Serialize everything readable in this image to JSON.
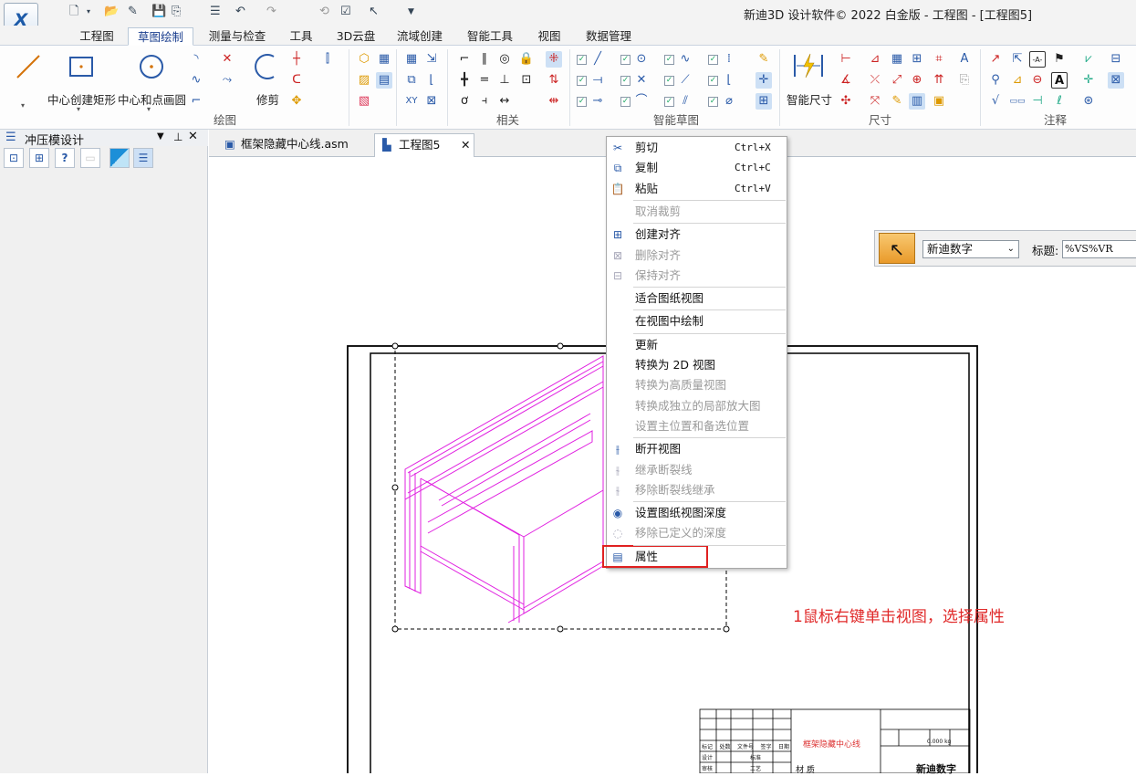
{
  "window": {
    "title": "新迪3D 设计软件© 2022 白金版 - 工程图 - [工程图5]"
  },
  "ribbon_tabs": [
    "工程图",
    "草图绘制",
    "测量与检查",
    "工具",
    "3D云盘",
    "流域创建",
    "智能工具",
    "视图",
    "数据管理"
  ],
  "ribbon": {
    "draw_big": [
      "中心创建矩形",
      "中心和点画圆"
    ],
    "trim_label": "修剪",
    "smart_dim_label": "智能尺寸",
    "group_labels": {
      "draw": "绘图",
      "relate": "相关",
      "smart_sketch": "智能草图",
      "dimension": "尺寸",
      "annotate": "注释"
    }
  },
  "left_panel": {
    "title": "冲压模设计"
  },
  "doc_tabs": [
    {
      "label": "框架隐藏中心线.asm",
      "active": false
    },
    {
      "label": "工程图5",
      "active": true,
      "close": "✕"
    }
  ],
  "context_menu": [
    {
      "type": "item",
      "label": "剪切",
      "shortcut": "Ctrl+X",
      "icon": "scissors-icon",
      "enabled": true
    },
    {
      "type": "item",
      "label": "复制",
      "shortcut": "Ctrl+C",
      "icon": "copy-icon",
      "enabled": true
    },
    {
      "type": "item",
      "label": "粘贴",
      "shortcut": "Ctrl+V",
      "icon": "paste-icon",
      "enabled": true
    },
    {
      "type": "sep"
    },
    {
      "type": "item",
      "label": "取消裁剪",
      "enabled": false
    },
    {
      "type": "sep"
    },
    {
      "type": "item",
      "label": "创建对齐",
      "icon": "align-create-icon",
      "enabled": true
    },
    {
      "type": "item",
      "label": "删除对齐",
      "icon": "align-delete-icon",
      "enabled": false
    },
    {
      "type": "item",
      "label": "保持对齐",
      "icon": "align-keep-icon",
      "enabled": false
    },
    {
      "type": "sep"
    },
    {
      "type": "item",
      "label": "适合图纸视图",
      "enabled": true
    },
    {
      "type": "sep"
    },
    {
      "type": "item",
      "label": "在视图中绘制",
      "enabled": true
    },
    {
      "type": "sep"
    },
    {
      "type": "item",
      "label": "更新",
      "enabled": true
    },
    {
      "type": "item",
      "label": "转换为 2D 视图",
      "enabled": true
    },
    {
      "type": "item",
      "label": "转换为高质量视图",
      "enabled": false
    },
    {
      "type": "item",
      "label": "转换成独立的局部放大图",
      "enabled": false
    },
    {
      "type": "item",
      "label": "设置主位置和备选位置",
      "enabled": false
    },
    {
      "type": "sep"
    },
    {
      "type": "item",
      "label": "断开视图",
      "icon": "break-view-icon",
      "enabled": true
    },
    {
      "type": "item",
      "label": "继承断裂线",
      "icon": "inherit-break-icon",
      "enabled": false
    },
    {
      "type": "item",
      "label": "移除断裂线继承",
      "icon": "remove-break-icon",
      "enabled": false
    },
    {
      "type": "sep"
    },
    {
      "type": "item",
      "label": "设置图纸视图深度",
      "icon": "depth-icon",
      "enabled": true
    },
    {
      "type": "item",
      "label": "移除已定义的深度",
      "icon": "remove-depth-icon",
      "enabled": false
    },
    {
      "type": "sep"
    },
    {
      "type": "item",
      "label": "属性",
      "icon": "properties-icon",
      "enabled": true,
      "highlighted": true
    }
  ],
  "float_toolbar": {
    "font_select": "新迪数字",
    "title_label": "标题:",
    "title_value": "%VS%VR"
  },
  "annotation": "1鼠标右键单击视图，选择属性",
  "title_block": {
    "drawing_name": "框架隐藏中心线",
    "row_labels": [
      "标记",
      "处数",
      "文件号",
      "签字",
      "日期"
    ],
    "row_labels2": [
      "设计",
      "标准",
      "审核",
      "工艺"
    ],
    "material": "材 质",
    "mass": "0.000 kg",
    "company": "新迪数字"
  },
  "colors": {
    "accent": "#1a3e8e",
    "annotation": "#e02828",
    "model": "#e020e0",
    "highlight": "#e02020"
  }
}
